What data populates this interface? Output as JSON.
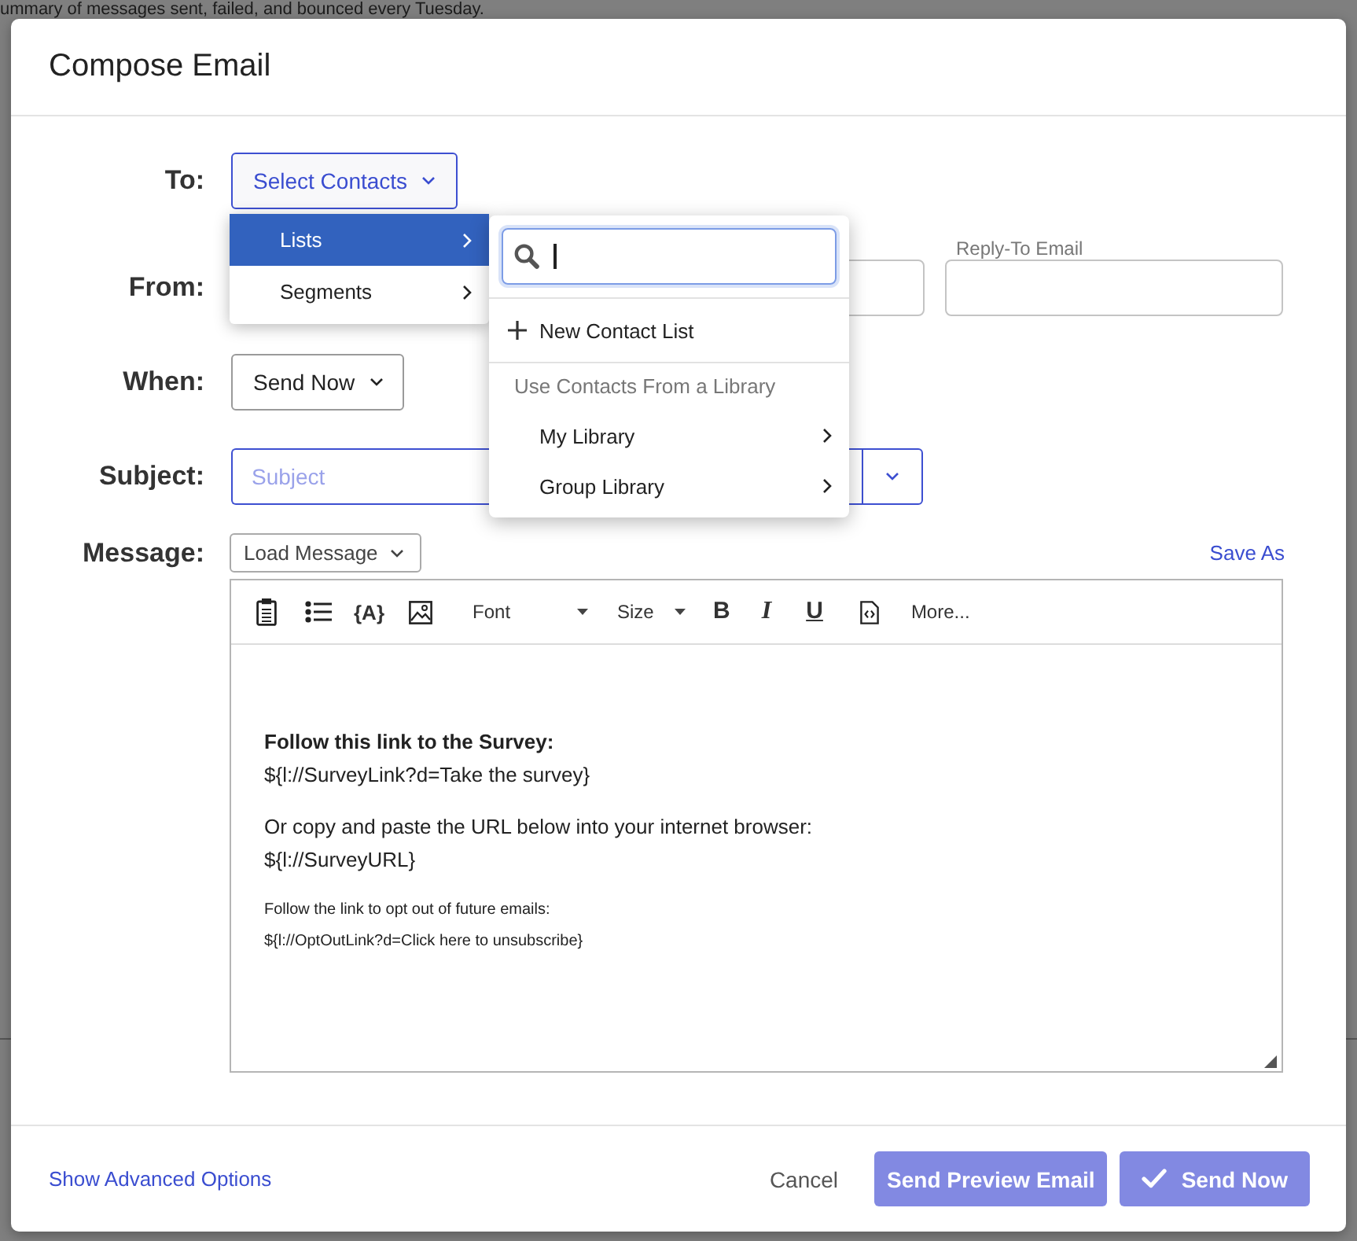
{
  "background": {
    "text": "ummary of messages sent, failed, and bounced every Tuesday."
  },
  "dialog": {
    "title": "Compose Email"
  },
  "to": {
    "label": "To:",
    "button": "Select Contacts"
  },
  "from": {
    "label": "From:",
    "reply_to": {
      "label": "Reply-To Email"
    }
  },
  "when": {
    "label": "When:",
    "value": "Send Now"
  },
  "subject": {
    "label": "Subject:",
    "placeholder": "Subject"
  },
  "message": {
    "label": "Message:",
    "load_button": "Load Message",
    "save_as": "Save As"
  },
  "contacts_menu": {
    "items": [
      {
        "label": "Lists",
        "selected": true
      },
      {
        "label": "Segments",
        "selected": false
      }
    ]
  },
  "lists_submenu": {
    "search": {
      "focused": true
    },
    "new_list": "New Contact List",
    "section_header": "Use Contacts From a Library",
    "libraries": [
      {
        "label": "My Library"
      },
      {
        "label": "Group Library"
      }
    ]
  },
  "editor": {
    "toolbar": {
      "piped_text": "{A}",
      "font": "Font",
      "size": "Size",
      "format": [
        {
          "kind": "bold",
          "text": "B"
        },
        {
          "kind": "italic",
          "text": "I"
        },
        {
          "kind": "underline",
          "text": "U"
        }
      ],
      "more": "More..."
    },
    "body": [
      {
        "kind": "normal",
        "lines": [
          {
            "text": "Follow this link to the Survey:",
            "bold": true
          },
          {
            "text": "${l://SurveyLink?d=Take the survey}",
            "bold": false
          }
        ]
      },
      {
        "kind": "normal",
        "lines": [
          {
            "text": "Or copy and paste the URL below into your internet browser:",
            "bold": false
          },
          {
            "text": "${l://SurveyURL}",
            "bold": false
          }
        ]
      },
      {
        "kind": "small",
        "lines": [
          {
            "text": "Follow the link to opt out of future emails:",
            "bold": false
          },
          {
            "text": "${l://OptOutLink?d=Click here to unsubscribe}",
            "bold": false
          }
        ]
      }
    ]
  },
  "footer": {
    "advanced_link": "Show Advanced Options",
    "cancel": "Cancel",
    "preview_button": {
      "label": "Send Preview Email",
      "disabled": true
    },
    "send_button": {
      "label": "Send Now",
      "disabled": true
    }
  }
}
